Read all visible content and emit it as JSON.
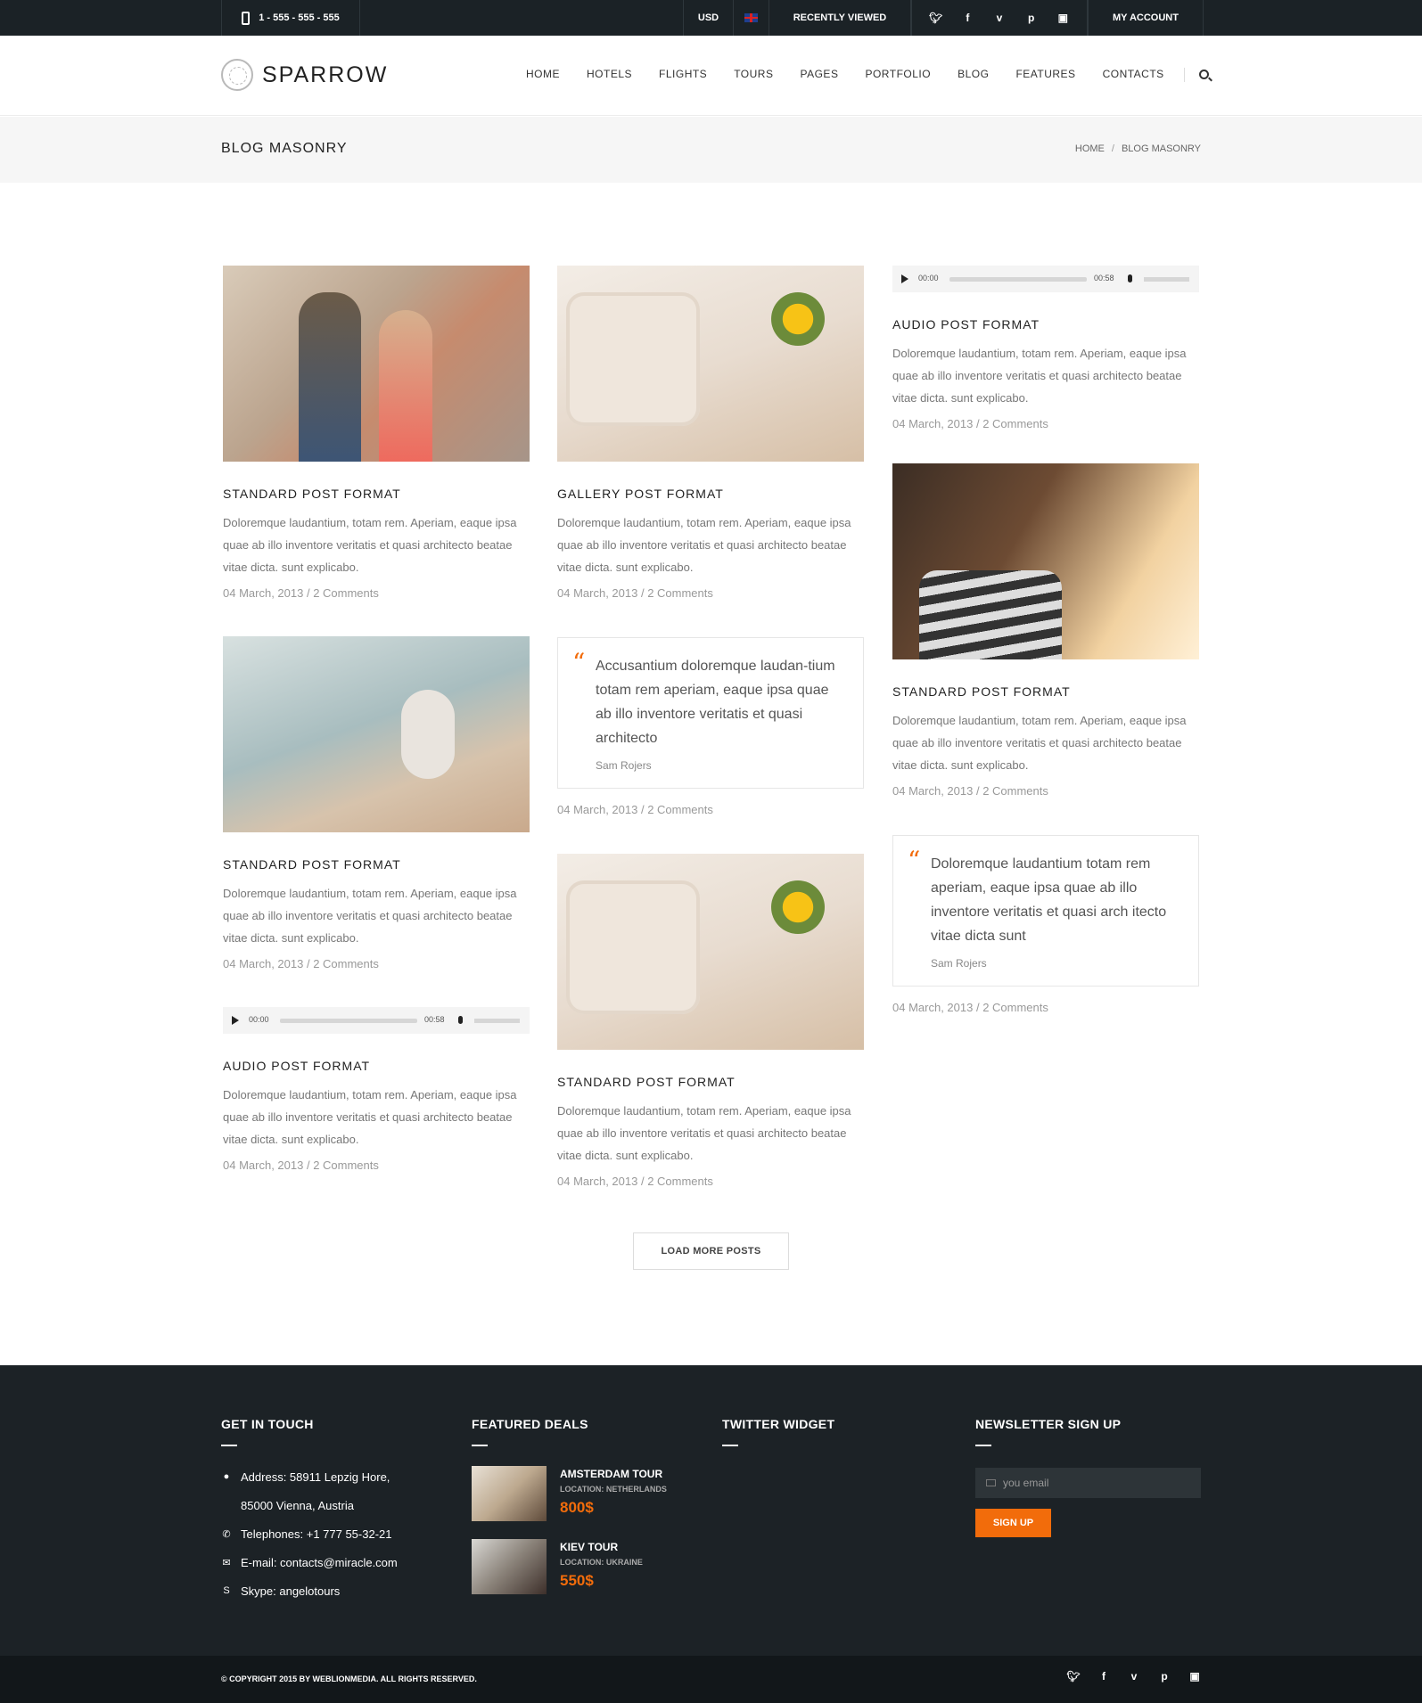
{
  "topbar": {
    "phone": "1 - 555 - 555 - 555",
    "currency": "USD",
    "recently_viewed": "RECENTLY VIEWED",
    "my_account": "MY ACCOUNT",
    "socials": [
      "twitter",
      "facebook",
      "vimeo",
      "pinterest",
      "instagram"
    ]
  },
  "header": {
    "logo": "SPARROW",
    "nav": [
      "HOME",
      "HOTELS",
      "FLIGHTS",
      "TOURS",
      "PAGES",
      "PORTFOLIO",
      "BLOG",
      "FEATURES",
      "CONTACTS"
    ]
  },
  "titlebar": {
    "title": "BLOG MASONRY",
    "breadcrumb_home": "HOME",
    "breadcrumb_sep": "/",
    "breadcrumb_current": "BLOG MASONRY"
  },
  "posts": {
    "excerpt": "Doloremque laudantium, totam rem. Aperiam, eaque ipsa quae ab illo inventore veritatis et quasi architecto beatae vitae dicta. sunt explicabo.",
    "meta_date": "04 March, 2013",
    "meta_comments": "2 Comments",
    "meta_sep": " / ",
    "standard_title": "STANDARD POST FORMAT",
    "gallery_title": "GALLERY POST FORMAT",
    "audio_title": "AUDIO POST FORMAT",
    "audio_time_start": "00:00",
    "audio_time_end": "00:58",
    "audio_volume": 0.8,
    "quote1_text": "Accusantium doloremque laudan-tium totam rem aperiam, eaque ipsa quae ab illo inventore veritatis et quasi architecto",
    "quote2_text": "Doloremque laudantium totam rem aperiam, eaque ipsa quae ab illo inventore veritatis et quasi arch itecto vitae dicta sunt",
    "quote_author": "Sam Rojers",
    "load_more": "LOAD MORE POSTS"
  },
  "footer": {
    "contact": {
      "title": "GET IN TOUCH",
      "address1": "Address: 58911 Lepzig Hore,",
      "address2": "85000 Vienna, Austria",
      "telephone": "Telephones: +1 777 55-32-21",
      "email": "E-mail: contacts@miracle.com",
      "skype": "Skype: angelotours"
    },
    "deals": {
      "title": "FEATURED DEALS",
      "items": [
        {
          "name": "AMSTERDAM TOUR",
          "location": "LOCATION: NETHERLANDS",
          "price": "800$"
        },
        {
          "name": "KIEV TOUR",
          "location": "LOCATION: UKRAINE",
          "price": "550$"
        }
      ]
    },
    "twitter": {
      "title": "TWITTER WIDGET"
    },
    "newsletter": {
      "title": "NEWSLETTER SIGN UP",
      "placeholder": "you email",
      "button": "SIGN UP"
    },
    "copyright": "© COPYRIGHT 2015 BY WEBLIONMEDIA. ALL RIGHTS RESERVED."
  },
  "colors": {
    "accent": "#f26c0b",
    "dark": "#1b2226"
  }
}
